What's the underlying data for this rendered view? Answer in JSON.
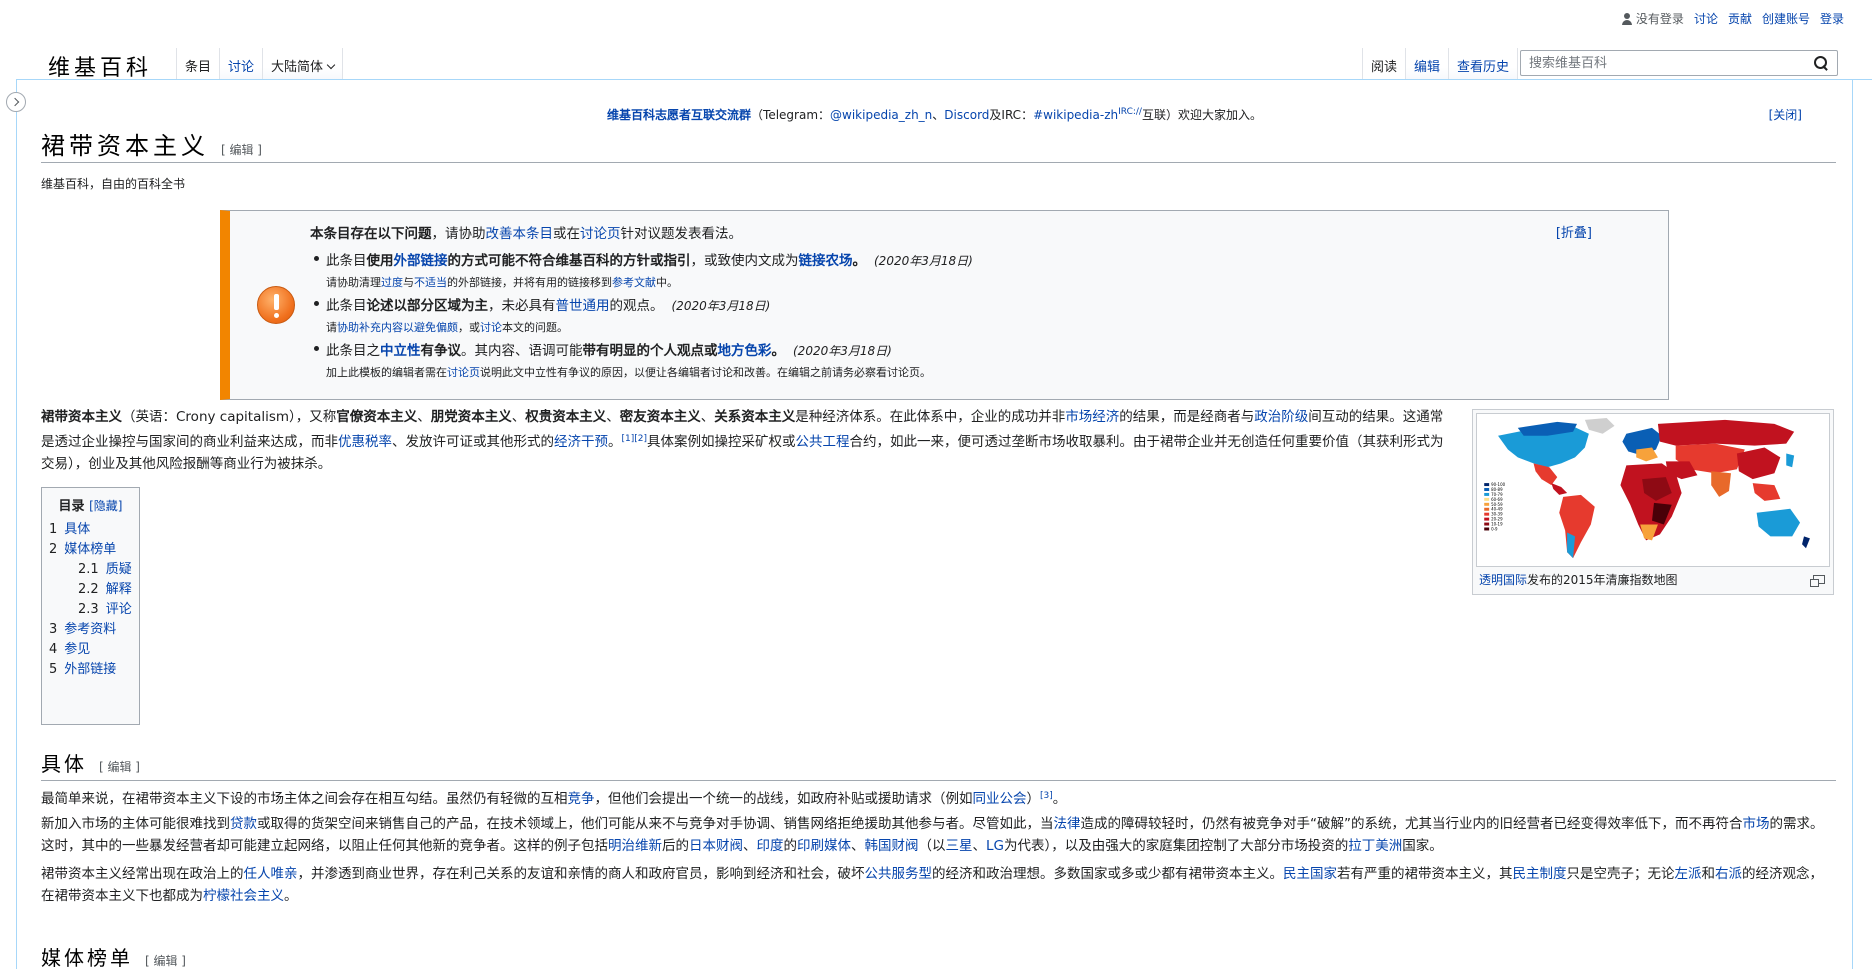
{
  "personal": {
    "anon_label": "没有登录",
    "talk": "讨论",
    "contributions": "贡献",
    "create_account": "创建账号",
    "login": "登录"
  },
  "logo": "维基百科",
  "tabs": {
    "article": "条目",
    "talk": "讨论",
    "variant": "大陆简体",
    "read": "阅读",
    "edit": "编辑",
    "history": "查看历史"
  },
  "search": {
    "placeholder": "搜索维基百科"
  },
  "sitenotice": {
    "title": "维基百科志愿者互联交流群",
    "p1": "（Telegram：",
    "tg": "@wikipedia_zh_n",
    "sep1": "、",
    "discord": "Discord",
    "p2": "及IRC：",
    "irc": "#wikipedia-zh",
    "irc_sup": "IRC://",
    "p3": "互联）欢迎大家加入。",
    "close": "[关闭]"
  },
  "page": {
    "title": "裙带资本主义",
    "edit_link": "[ 编辑 ]",
    "tagline": "维基百科，自由的百科全书"
  },
  "ambox": {
    "intro_a": "本条目存在以下问题",
    "intro_b": "，请协助",
    "intro_link1": "改善本条目",
    "intro_c": "或在",
    "intro_link2": "讨论页",
    "intro_d": "针对议题发表看法。",
    "collapse": "[折叠]",
    "issue1": {
      "a": "此条目",
      "b": "使用",
      "link1": "外部链接",
      "c": "的方式可能不符合维基百科的方针或指引",
      "d": "，或致使内文成为",
      "link2": "链接农场",
      "e": "。",
      "date": "(2020年3月18日)",
      "sub_a": "请协助清理",
      "sub_l1": "过度",
      "sub_b": "与",
      "sub_l2": "不适当",
      "sub_c": "的外部链接，并将有用的链接移到",
      "sub_l3": "参考文献",
      "sub_d": "中。"
    },
    "issue2": {
      "a": "此条目",
      "b": "论述以部分区域为主",
      "c": "，未必具有",
      "link1": "普世通用",
      "d": "的观点。",
      "date": "(2020年3月18日)",
      "sub_a": "请",
      "sub_l1": "协助补充内容以避免偏颇",
      "sub_b": "，或",
      "sub_l2": "讨论",
      "sub_c": "本文的问题。"
    },
    "issue3": {
      "a": "此条目之",
      "link1": "中立性",
      "b": "有争议",
      "c": "。其内容、语调可能",
      "d": "带有明显的个人观点或",
      "link2": "地方色彩",
      "e": "。",
      "date": "(2020年3月18日)",
      "sub_a": "加上此模板的编辑者需在",
      "sub_l1": "讨论页",
      "sub_b": "说明此文中立性有争议的原因，以便让各编辑者讨论和改善。在编辑之前请务必察看讨论页。"
    }
  },
  "lead": {
    "t1": "裙带资本主义",
    "t2": "（英语：Crony capitalism），又称",
    "b1": "官僚资本主义",
    "s1": "、",
    "b2": "朋党资本主义",
    "s2": "、",
    "b3": "权贵资本主义",
    "s3": "、",
    "b4": "密友资本主义",
    "s4": "、",
    "b5": "关系资本主义",
    "t3": "是种经济体系。在此体系中，企业的成功并非",
    "l1": "市场经济",
    "t4": "的结果，而是经商者与",
    "l2": "政治阶级",
    "t5": "间互动的结果。这通常是透过企业操控与国家间的商业利益来达成，而非",
    "l3": "优惠税率",
    "t6": "、发放许可证或其他形式的",
    "l4": "经济干预",
    "t7": "。",
    "ref": "[1][2]",
    "t8": "具体案例如操控采矿权或",
    "l5": "公共工程",
    "t9": "合约，如此一来，便可透过垄断市场收取暴利。由于裙带企业并无创造任何重要价值（其获利形式为交易），创业及其他风险报酬等商业行为被抹杀。"
  },
  "figure": {
    "caption_link": "透明国际",
    "caption": "发布的2015年清廉指数地图",
    "legend": [
      "90-100",
      "80-89",
      "70-79",
      "60-69",
      "50-59",
      "40-49",
      "30-39",
      "20-29",
      "10-19",
      "0-9"
    ],
    "legend_colors": [
      "#00246b",
      "#0a5fb5",
      "#1a9bd7",
      "#ffe08a",
      "#f7a23b",
      "#e8692a",
      "#e63a2e",
      "#c1121f",
      "#8e0a14",
      "#4a0008"
    ]
  },
  "toc": {
    "title": "目录",
    "hide": "[隐藏]",
    "items": [
      {
        "num": "1",
        "label": "具体",
        "level": 1
      },
      {
        "num": "2",
        "label": "媒体榜单",
        "level": 1
      },
      {
        "num": "2.1",
        "label": "质疑",
        "level": 2
      },
      {
        "num": "2.2",
        "label": "解释",
        "level": 2
      },
      {
        "num": "2.3",
        "label": "评论",
        "level": 2
      },
      {
        "num": "3",
        "label": "参考资料",
        "level": 1
      },
      {
        "num": "4",
        "label": "参见",
        "level": 1
      },
      {
        "num": "5",
        "label": "外部链接",
        "level": 1
      }
    ]
  },
  "section1": {
    "heading": "具体",
    "edit": "[ 编辑 ]",
    "p1_a": "最简单来说，在裙带资本主义下设的市场主体之间会存在相互勾结。虽然仍有轻微的互相",
    "p1_l1": "竞争",
    "p1_b": "，但他们会提出一个统一的战线，如政府补贴或援助请求（例如",
    "p1_l2": "同业公会",
    "p1_c": "）",
    "p1_ref": "[3]",
    "p1_d": "。",
    "p2_a": "新加入市场的主体可能很难找到",
    "p2_l1": "贷款",
    "p2_b": "或取得的货架空间来销售自己的产品，在技术领域上，他们可能从来不与竞争对手协调、销售网络拒绝援助其他参与者。尽管如此，当",
    "p2_l2": "法律",
    "p2_c": "造成的障碍较轻时，仍然有被竞争对手“破解”的系统，尤其当行业内的旧经营者已经变得效率低下，而不再符合",
    "p2_l3": "市场",
    "p2_d": "的需求。这时，其中的一些暴发经营者却可能建立起网络，以阻止任何其他新的竞争者。这样的例子包括",
    "p2_l4": "明治维新",
    "p2_e": "后的",
    "p2_l5": "日本财阀",
    "p2_f": "、",
    "p2_l6": "印度",
    "p2_g": "的",
    "p2_l7": "印刷媒体",
    "p2_h": "、",
    "p2_l8": "韩国财阀",
    "p2_i": "（以",
    "p2_l9": "三星",
    "p2_j": "、",
    "p2_l10": "LG",
    "p2_k": "为代表），以及由强大的家庭集团控制了大部分市场投资的",
    "p2_l11": "拉丁美洲",
    "p2_l": "国家。",
    "p3_a": "裙带资本主义经常出现在政治上的",
    "p3_l1": "任人唯亲",
    "p3_b": "，并渗透到商业世界，存在利己关系的友谊和亲情的商人和政府官员，影响到经济和社会，破坏",
    "p3_l2": "公共服务型",
    "p3_c": "的经济和政治理想。多数国家或多或少都有裙带资本主义。",
    "p3_l3": "民主国家",
    "p3_d": "若有严重的裙带资本主义，其",
    "p3_l4": "民主制度",
    "p3_e": "只是空壳子；无论",
    "p3_l5": "左派",
    "p3_f": "和",
    "p3_l6": "右派",
    "p3_g": "的经济观念，在裙带资本主义下也都成为",
    "p3_l7": "柠檬社会主义",
    "p3_h": "。"
  },
  "section2": {
    "heading": "媒体榜单",
    "edit": "[ 编辑 ]"
  }
}
